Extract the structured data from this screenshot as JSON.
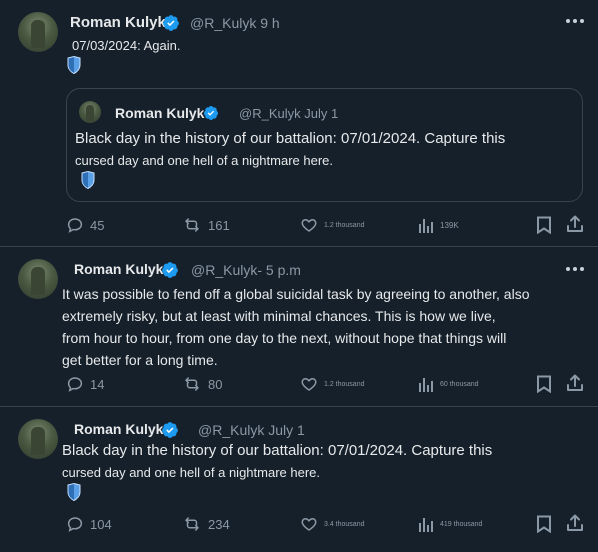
{
  "tweets": [
    {
      "author": "Roman Kulyk",
      "handle_time": "@R_Kulyk 9 h",
      "text": "07/03/2024: Again.",
      "quote": {
        "author": "Roman Kulyk",
        "handle_time": "@R_Kulyk July 1",
        "line1": "Black day in the history of our battalion: 07/01/2024. Capture this",
        "line2": "cursed day and one hell of a nightmare here."
      },
      "replies": "45",
      "retweets": "161",
      "likes": "1.2 thousand",
      "views": "139K"
    },
    {
      "author": "Roman Kulyk",
      "handle_time": "@R_Kulyk- 5 p.m",
      "lines": [
        "It was possible to fend off a global suicidal task by agreeing to another, also",
        "extremely risky, but at least with minimal chances. This is how we live,",
        "from hour to hour, from one day to the next, without hope that things will",
        "get better for a long time."
      ],
      "replies": "14",
      "retweets": "80",
      "likes": "1.2 thousand",
      "views": "60 thousand"
    },
    {
      "author": "Roman Kulyk",
      "handle_time": "@R_Kulyk July 1",
      "line1": "Black day in the history of our battalion: 07/01/2024. Capture this",
      "line2": "cursed day and one hell of a nightmare here.",
      "replies": "104",
      "retweets": "234",
      "likes": "3.4 thousand",
      "views": "419 thousand"
    }
  ],
  "colors": {
    "background": "#15202b",
    "verified": "#1d9bf0",
    "muted": "#8b98a5",
    "border": "#38444d",
    "shield": "#5aa0e6"
  },
  "icons": [
    "verified-badge-icon",
    "more-icon",
    "shield-icon",
    "reply-icon",
    "retweet-icon",
    "like-icon",
    "views-icon",
    "bookmark-icon",
    "share-icon"
  ]
}
